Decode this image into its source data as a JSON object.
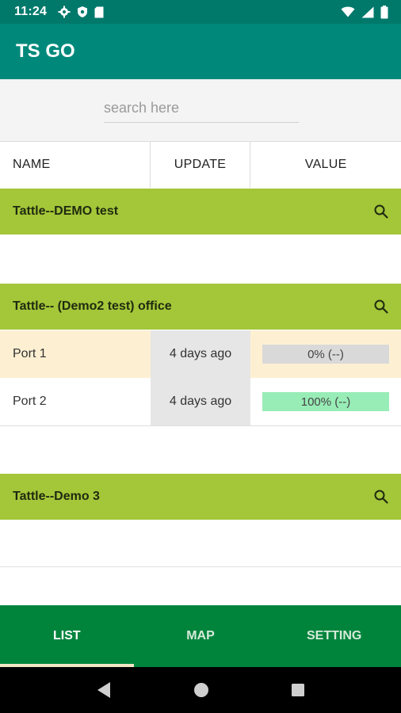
{
  "status_bar": {
    "time": "11:24",
    "icons": [
      "settings-icon",
      "shield-icon",
      "sd-card-icon",
      "wifi-icon",
      "signal-icon",
      "battery-icon"
    ]
  },
  "app_bar": {
    "title": "TS GO"
  },
  "search": {
    "placeholder": "search here",
    "value": ""
  },
  "columns": {
    "name": "NAME",
    "update": "UPDATE",
    "value": "VALUE"
  },
  "groups": [
    {
      "name": "Tattle--DEMO test"
    },
    {
      "name": "Tattle-- (Demo2 test) office"
    },
    {
      "name": "Tattle--Demo 3"
    }
  ],
  "rows": [
    {
      "name": "Port 1",
      "update": "4 days ago",
      "value": "0% (--)",
      "row_bg": "#fdf0d2",
      "value_bg": "#d9d9d9"
    },
    {
      "name": "Port 2",
      "update": "4 days ago",
      "value": "100% (--)",
      "row_bg": "#ffffff",
      "value_bg": "#98ecb6"
    }
  ],
  "bottom_nav": {
    "tabs": [
      "LIST",
      "MAP",
      "SETTING"
    ],
    "active": "LIST"
  },
  "colors": {
    "status_bar": "#00796b",
    "app_bar": "#00897b",
    "group_header": "#a4c639",
    "bottom_nav": "#00843c",
    "tab_indicator": "#f3e6c6"
  }
}
